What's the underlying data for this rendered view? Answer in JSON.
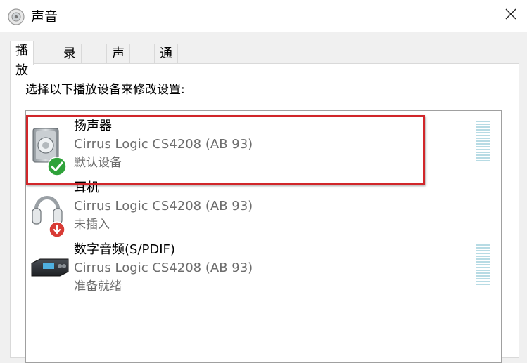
{
  "window": {
    "title": "声音",
    "close_icon": "close-icon",
    "title_icon": "speaker-icon"
  },
  "tabs": [
    {
      "label": "播放",
      "active": true
    },
    {
      "label": "录制",
      "active": false
    },
    {
      "label": "声音",
      "active": false
    },
    {
      "label": "通信",
      "active": false
    }
  ],
  "instruction": "选择以下播放设备来修改设置:",
  "devices": [
    {
      "name": "扬声器",
      "driver": "Cirrus Logic CS4208 (AB 93)",
      "status": "默认设备",
      "icon": "speaker-icon",
      "badge": "default-check-icon",
      "selected": true
    },
    {
      "name": "耳机",
      "driver": "Cirrus Logic CS4208 (AB 93)",
      "status": "未插入",
      "icon": "headphones-icon",
      "badge": "unplugged-icon",
      "selected": false
    },
    {
      "name": "数字音频(S/PDIF)",
      "driver": "Cirrus Logic CS4208 (AB 93)",
      "status": "准备就绪",
      "icon": "digital-audio-icon",
      "badge": "",
      "selected": false
    }
  ],
  "colors": {
    "highlight": "#d1262a",
    "secondary_text": "#6d6d6d",
    "meter": "#b7dbe4"
  }
}
